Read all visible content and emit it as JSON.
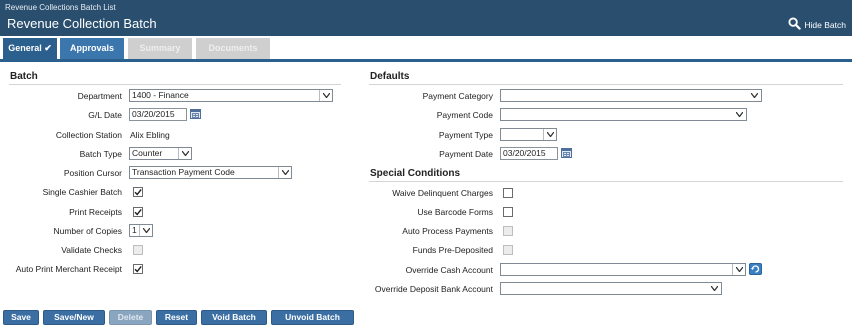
{
  "header": {
    "breadcrumb": "Revenue Collections Batch List",
    "title": "Revenue Collection Batch",
    "hide_search_label": "Hide Batch"
  },
  "tabs": [
    {
      "label": "General",
      "state": "active",
      "check": "✔"
    },
    {
      "label": "Approvals",
      "state": "enabled"
    },
    {
      "label": "Summary",
      "state": "disabled"
    },
    {
      "label": "Documents",
      "state": "disabled"
    }
  ],
  "batch": {
    "section_title": "Batch",
    "department": {
      "label": "Department",
      "value": "1400 - Finance"
    },
    "gl_date": {
      "label": "G/L Date",
      "value": "03/20/2015"
    },
    "collection_station": {
      "label": "Collection Station",
      "value": "Alix Ebling"
    },
    "batch_type": {
      "label": "Batch Type",
      "value": "Counter"
    },
    "position_cursor": {
      "label": "Position Cursor",
      "value": "Transaction Payment Code"
    },
    "single_cashier_batch": {
      "label": "Single Cashier Batch",
      "checked": true
    },
    "print_receipts": {
      "label": "Print Receipts",
      "checked": true
    },
    "number_of_copies": {
      "label": "Number of Copies",
      "value": "1"
    },
    "validate_checks": {
      "label": "Validate Checks",
      "checked": false,
      "disabled": true
    },
    "auto_print_merchant_receipt": {
      "label": "Auto Print Merchant Receipt",
      "checked": true
    }
  },
  "defaults": {
    "section_title": "Defaults",
    "payment_category": {
      "label": "Payment Category",
      "value": ""
    },
    "payment_code": {
      "label": "Payment Code",
      "value": ""
    },
    "payment_type": {
      "label": "Payment Type",
      "value": ""
    },
    "payment_date": {
      "label": "Payment Date",
      "value": "03/20/2015"
    }
  },
  "special": {
    "section_title": "Special Conditions",
    "waive_delinquent_charges": {
      "label": "Waive Delinquent Charges",
      "checked": false
    },
    "use_barcode_forms": {
      "label": "Use Barcode Forms",
      "checked": false
    },
    "auto_process_payments": {
      "label": "Auto Process Payments",
      "checked": false,
      "disabled": true
    },
    "funds_pre_deposited": {
      "label": "Funds Pre-Deposited",
      "checked": false,
      "disabled": true
    },
    "override_cash_account": {
      "label": "Override Cash Account",
      "value": ""
    },
    "override_deposit_bank_account": {
      "label": "Override Deposit Bank Account",
      "value": ""
    }
  },
  "buttons": {
    "save": "Save",
    "save_new": "Save/New",
    "delete": "Delete",
    "reset": "Reset",
    "void_batch": "Void Batch",
    "unvoid_batch": "Unvoid Batch"
  },
  "colors": {
    "header_bg": "#294e6e",
    "tab_active": "#2b5f8e",
    "tab_enabled": "#3b76ad",
    "tab_disabled": "#cfcfcf",
    "button_bg": "#3b6fa3"
  }
}
